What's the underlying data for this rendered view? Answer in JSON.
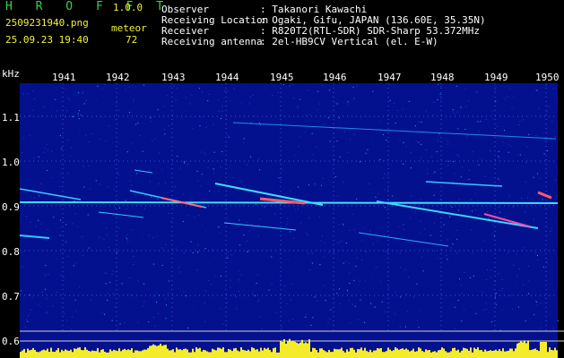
{
  "app": {
    "name": "H R O F F T",
    "version": "1.0.0",
    "file": "2509231940.png",
    "datetime": "25.09.23 19:40",
    "counter_label": "meteor",
    "counter_value": "72"
  },
  "info": {
    "labels": [
      "Observer",
      "Receiving Location",
      "Receiver",
      "Receiving antenna"
    ],
    "values": [
      ": Takanori Kawachi",
      ": Ogaki, Gifu, JAPAN (136.60E, 35.35N)",
      ": R820T2(RTL-SDR) SDR-Sharp 53.372MHz",
      ": 2el-HB9CV Vertical (el. E-W)"
    ]
  },
  "plot": {
    "y_unit": "kHz",
    "y_ticks": [
      "1.1",
      "1.0",
      "0.9",
      "0.8",
      "0.7",
      "0.6"
    ],
    "x_ticks": [
      "1941",
      "1942",
      "1943",
      "1944",
      "1945",
      "1946",
      "1947",
      "1948",
      "1949",
      "1950"
    ],
    "colors": {
      "background": "#04118e",
      "grid": "#3a4fd6",
      "signal": "#34d4ff",
      "level": "#f4ec2a"
    }
  }
}
